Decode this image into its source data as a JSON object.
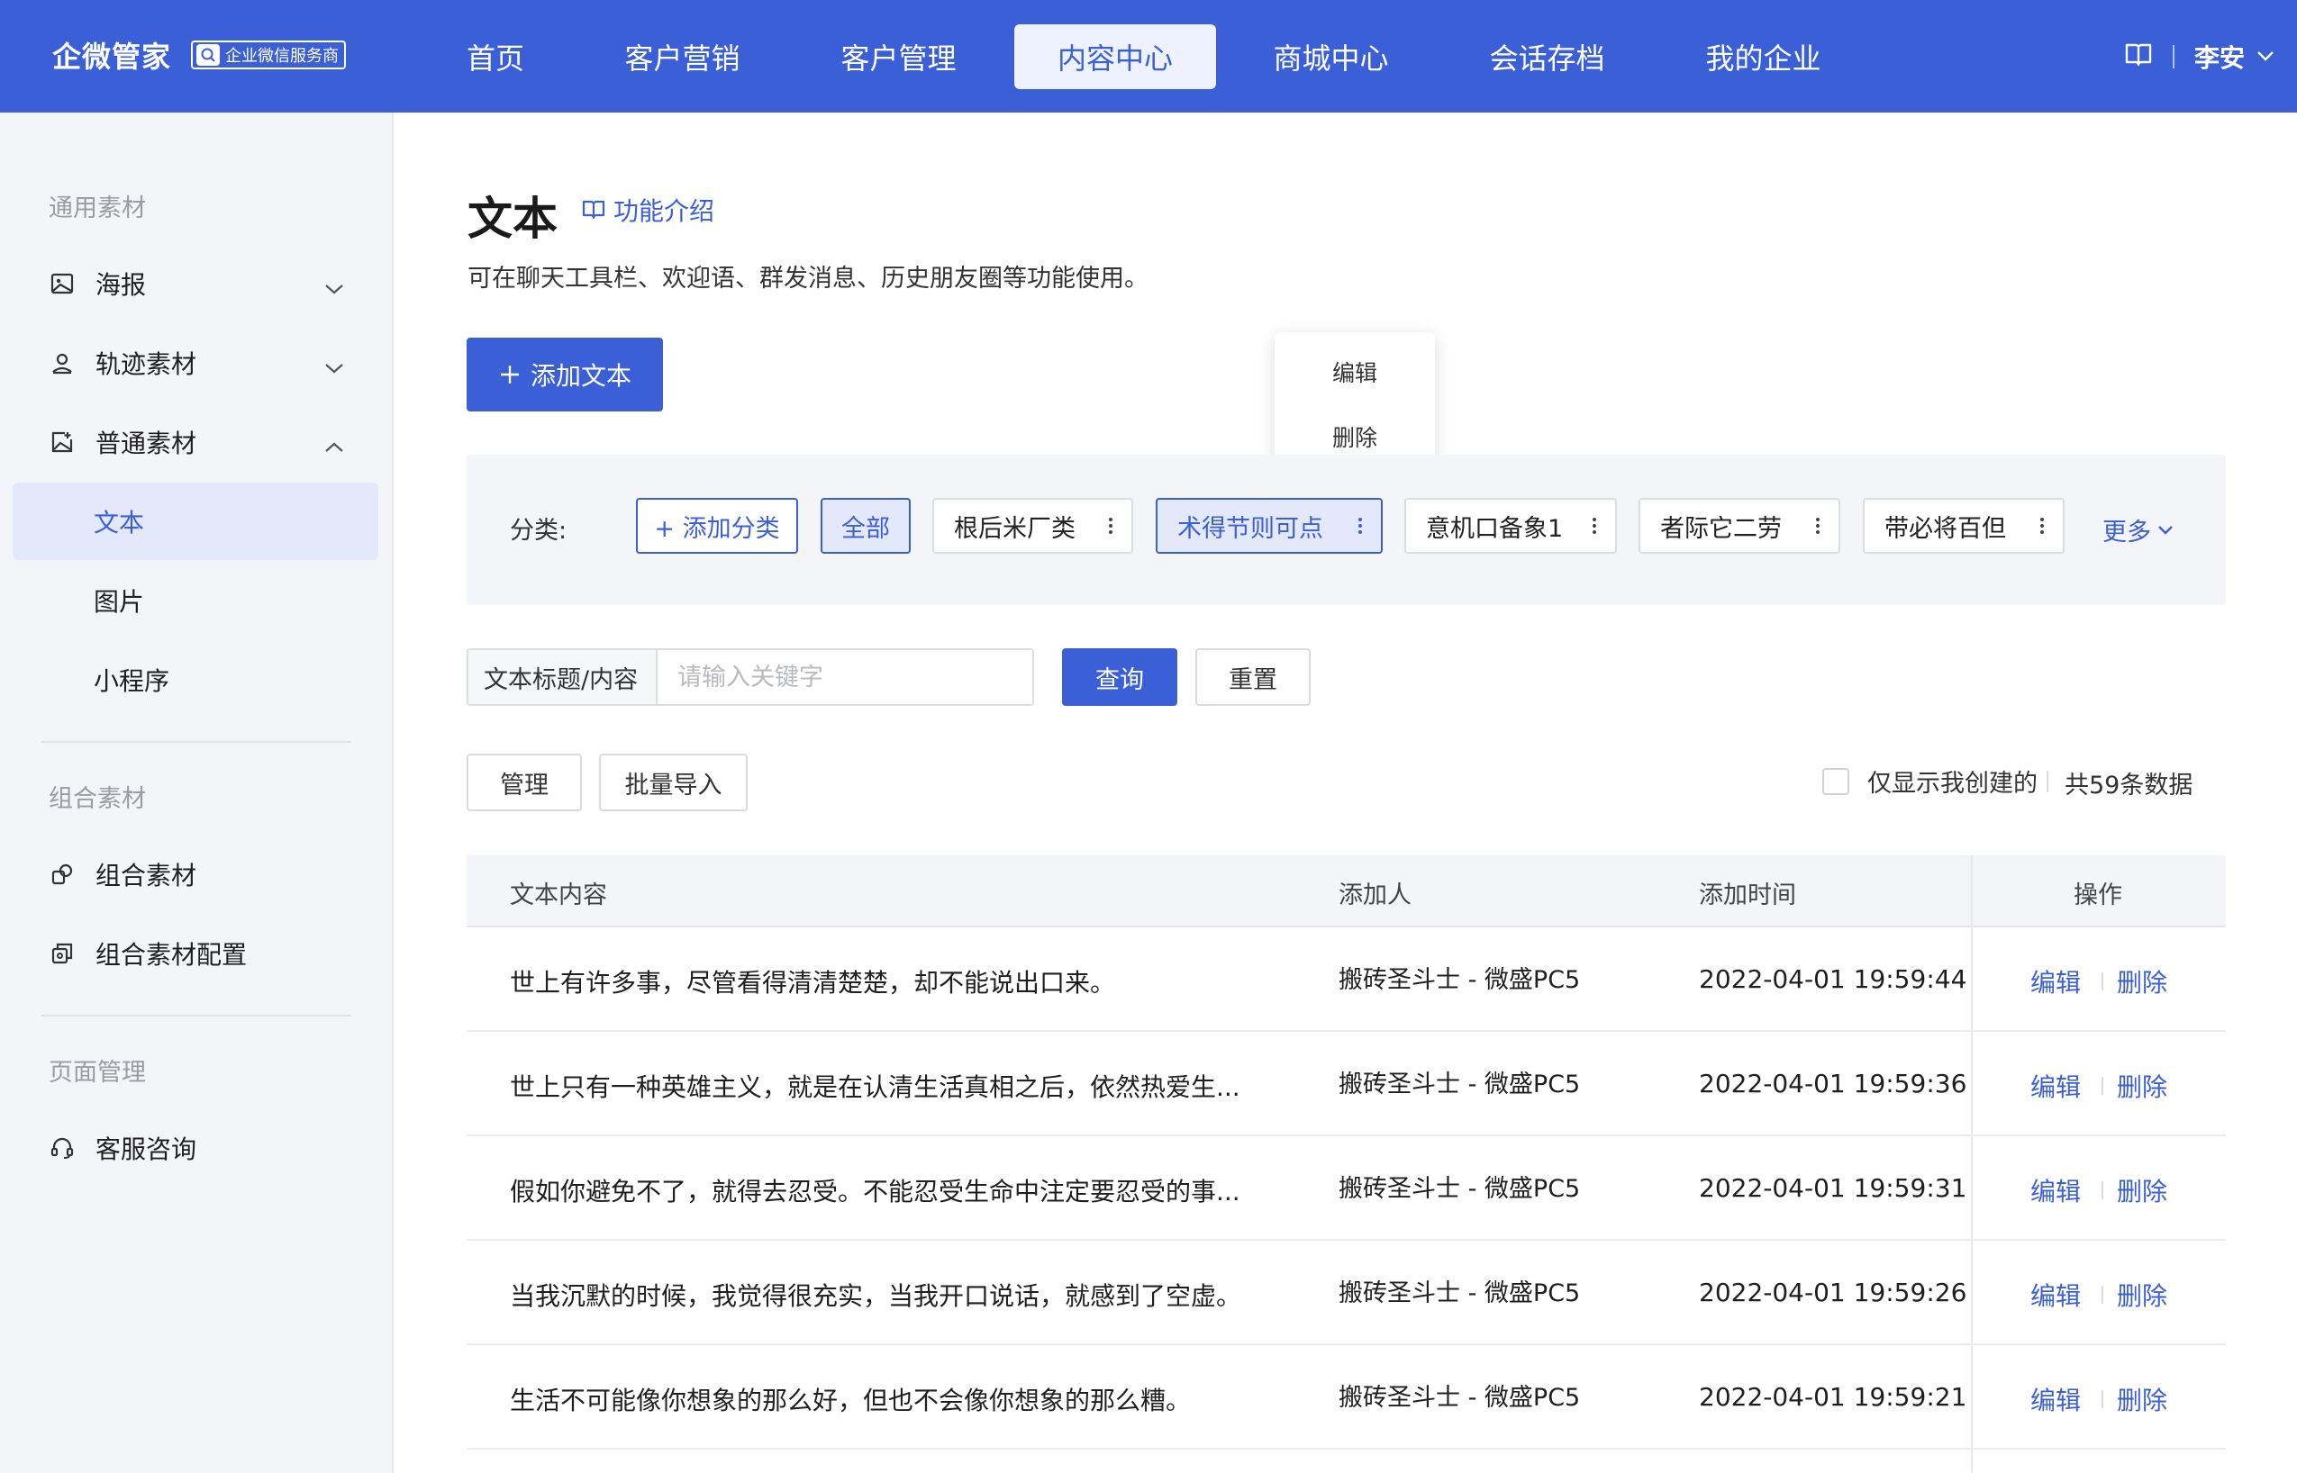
{
  "colors": {
    "primary": "#3b5fd6",
    "sidebar_bg": "#f4f5f8",
    "active_bg": "#e3e9fb"
  },
  "brand": {
    "name": "企微管家",
    "badge": "企业微信服务商"
  },
  "nav": {
    "items": [
      "首页",
      "客户营销",
      "客户管理",
      "内容中心",
      "商城中心",
      "会话存档",
      "我的企业"
    ],
    "active": "内容中心"
  },
  "user": {
    "name": "李安"
  },
  "sidebar": {
    "groups": {
      "general": "通用素材",
      "combo": "组合素材",
      "page": "页面管理"
    },
    "items": {
      "poster": "海报",
      "track": "轨迹素材",
      "normal": "普通素材",
      "text": "文本",
      "image": "图片",
      "miniprogram": "小程序",
      "combo": "组合素材",
      "combo_config": "组合素材配置",
      "service": "客服咨询"
    }
  },
  "page": {
    "title": "文本",
    "intro_link": "功能介绍",
    "description": "可在聊天工具栏、欢迎语、群发消息、历史朋友圈等功能使用。",
    "add_button": "添加文本"
  },
  "popup": {
    "edit": "编辑",
    "delete": "删除"
  },
  "categories": {
    "label": "分类:",
    "add": "+ 添加分类",
    "all": "全部",
    "items": [
      "根后米厂类",
      "术得节则可点",
      "意机口备象1",
      "者际它二劳",
      "带必将百但"
    ],
    "more": "更多"
  },
  "search": {
    "label": "文本标题/内容",
    "placeholder": "请输入关键字",
    "query": "查询",
    "reset": "重置"
  },
  "toolbar": {
    "manage": "管理",
    "import": "批量导入",
    "only_mine": "仅显示我创建的",
    "total": "共59条数据"
  },
  "table": {
    "headers": {
      "content": "文本内容",
      "adder": "添加人",
      "time": "添加时间",
      "ops": "操作"
    },
    "op_edit": "编辑",
    "op_delete": "删除",
    "rows": [
      {
        "content": "世上有许多事，尽管看得清清楚楚，却不能说出口来。",
        "adder": "搬砖圣斗士 - 微盛PC5",
        "time": "2022-04-01 19:59:44"
      },
      {
        "content": "世上只有一种英雄主义，就是在认清生活真相之后，依然热爱生...",
        "adder": "搬砖圣斗士 - 微盛PC5",
        "time": "2022-04-01 19:59:36"
      },
      {
        "content": "假如你避免不了，就得去忍受。不能忍受生命中注定要忍受的事...",
        "adder": "搬砖圣斗士 - 微盛PC5",
        "time": "2022-04-01 19:59:31"
      },
      {
        "content": "当我沉默的时候，我觉得很充实，当我开口说话，就感到了空虚。",
        "adder": "搬砖圣斗士 - 微盛PC5",
        "time": "2022-04-01 19:59:26"
      },
      {
        "content": "生活不可能像你想象的那么好，但也不会像你想象的那么糟。",
        "adder": "搬砖圣斗士 - 微盛PC5",
        "time": "2022-04-01 19:59:21"
      }
    ]
  }
}
